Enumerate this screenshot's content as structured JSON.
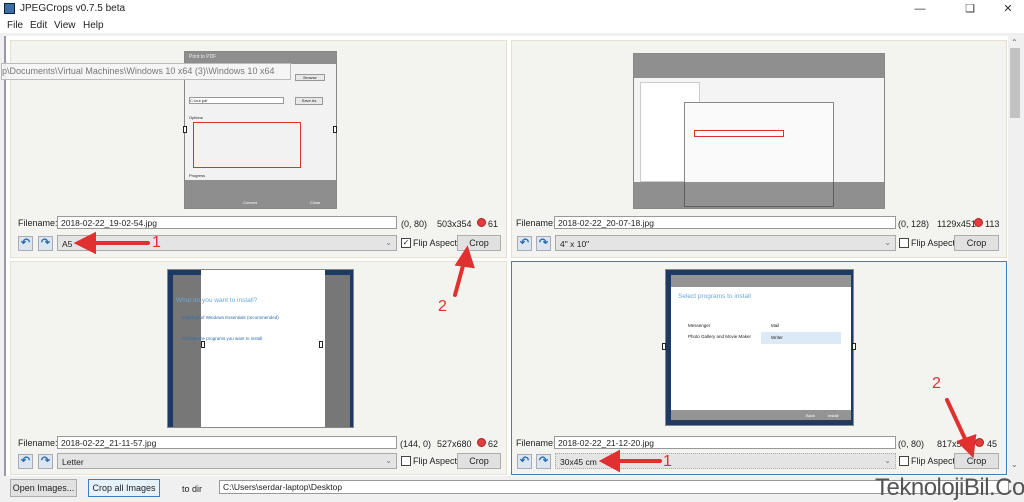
{
  "window": {
    "title": "JPEGCrops v0.7.5 beta",
    "controls": [
      "minimize",
      "maximize",
      "close"
    ]
  },
  "menu": [
    "File",
    "Edit",
    "View",
    "Help"
  ],
  "labels": {
    "filename": "Filename:",
    "flip_aspect": "Flip Aspect",
    "crop": "Crop"
  },
  "panels": [
    {
      "filename": "2018-02-22_19-02-54.jpg",
      "offset": "(0, 80)",
      "size": "503x354",
      "quality": "61",
      "aspect": "A5",
      "flip_aspect": true,
      "selected": false,
      "thumb_text": {
        "window": "Print to PDF",
        "path": "p\\Documents\\Virtual Machines\\Windows 10 x64 (3)\\Windows 10 x64",
        "browse": "Browse",
        "save_as": "Save As",
        "pdf_file": "C:\\out.pdf",
        "options": "Options",
        "convert": "Convert",
        "close": "Close",
        "progress": "Progress"
      }
    },
    {
      "filename": "2018-02-22_20-07-18.jpg",
      "offset": "(0, 128)",
      "size": "1129x451",
      "quality": "113",
      "aspect": "4\" x 10\"",
      "flip_aspect": false,
      "selected": false
    },
    {
      "filename": "2018-02-22_21-11-57.jpg",
      "offset": "(144, 0)",
      "size": "527x680",
      "quality": "62",
      "aspect": "Letter",
      "flip_aspect": false,
      "selected": false,
      "thumb_text": {
        "heading": "What do you want to install?",
        "link1": "Install all of Windows Essentials (recommended)",
        "link2": "Choose the programs you want to install"
      }
    },
    {
      "filename": "2018-02-22_21-12-20.jpg",
      "offset": "(0, 80)",
      "size": "817x5..",
      "quality": "45",
      "aspect": "30x45 cm",
      "flip_aspect": false,
      "selected": true,
      "thumb_text": {
        "heading": "Select programs to install",
        "item1": "Messenger",
        "item2": "Photo Gallery and Movie Maker",
        "item3": "Mail",
        "item4": "Writer",
        "install": "Install",
        "back": "Back"
      }
    }
  ],
  "annotations": [
    "1",
    "2",
    "1",
    "2"
  ],
  "footer": {
    "open_images": "Open Images...",
    "crop_all": "Crop all Images",
    "to_dir": "to dir",
    "dir": "C:\\Users\\serdar-laptop\\Desktop"
  },
  "watermark": "TeknolojiBil.Com",
  "colors": {
    "accent": "#3c7fc0",
    "annotation": "#e03030",
    "quality_dot": "#e43b3b"
  }
}
